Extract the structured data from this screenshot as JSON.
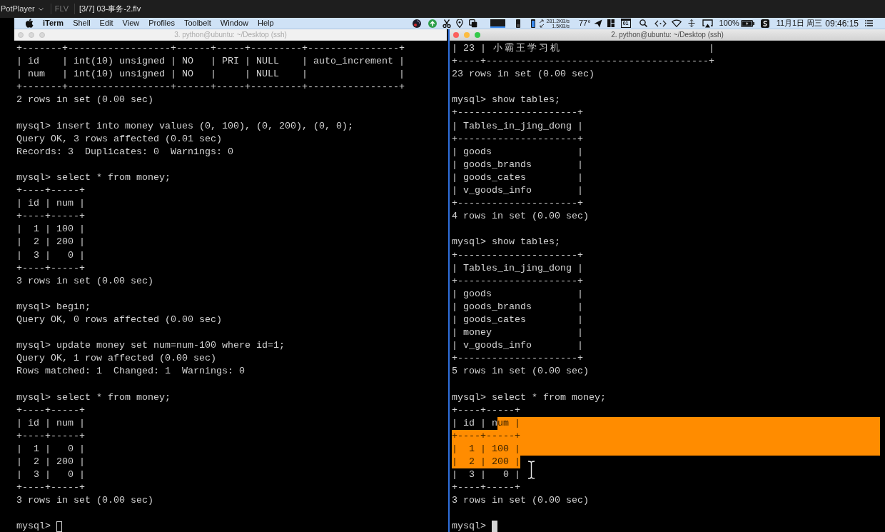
{
  "player_bar": {
    "app": "PotPlayer",
    "format": "FLV",
    "file_title": "[3/7] 03-事务-2.flv"
  },
  "menu_bar": {
    "items": [
      {
        "label": "iTerm",
        "kind": "app"
      },
      {
        "label": "Shell",
        "kind": "menu"
      },
      {
        "label": "Edit",
        "kind": "menu"
      },
      {
        "label": "View",
        "kind": "menu"
      },
      {
        "label": "Profiles",
        "kind": "menu"
      },
      {
        "label": "Toolbelt",
        "kind": "menu"
      },
      {
        "label": "Window",
        "kind": "menu"
      },
      {
        "label": "Help",
        "kind": "menu"
      }
    ],
    "upload_speed": "281.2KB/s",
    "download_speed": "1.5KB/s",
    "temperature": "77°",
    "calendar_day": "01",
    "battery": "100%",
    "date": "11月1日 周三",
    "time": "09:46:15"
  },
  "windows": [
    {
      "title": "3. python@ubuntu: ~/Desktop (ssh)",
      "focused": false,
      "blocks": [
        {
          "lines": [
            {
              "text": "+-------+------------------+------+-----+---------+----------------+",
              "selected": false
            },
            {
              "text": "| id    | int(10) unsigned | NO   | PRI | NULL    | auto_increment |",
              "selected": false
            },
            {
              "text": "| num   | int(10) unsigned | NO   |     | NULL    |                |",
              "selected": false
            },
            {
              "text": "+-------+------------------+------+-----+---------+----------------+",
              "selected": false
            },
            {
              "text": "2 rows in set (0.00 sec)",
              "selected": false
            }
          ]
        },
        {
          "lines": [
            {
              "text": "mysql> insert into money values (0, 100), (0, 200), (0, 0);",
              "selected": false
            },
            {
              "text": "Query OK, 3 rows affected (0.01 sec)",
              "selected": false
            },
            {
              "text": "Records: 3  Duplicates: 0  Warnings: 0",
              "selected": false
            }
          ]
        },
        {
          "lines": [
            {
              "text": "mysql> select * from money;",
              "selected": false
            },
            {
              "text": "+----+-----+",
              "selected": false
            },
            {
              "text": "| id | num |",
              "selected": false
            },
            {
              "text": "+----+-----+",
              "selected": false
            },
            {
              "text": "|  1 | 100 |",
              "selected": false
            },
            {
              "text": "|  2 | 200 |",
              "selected": false
            },
            {
              "text": "|  3 |   0 |",
              "selected": false
            },
            {
              "text": "+----+-----+",
              "selected": false
            },
            {
              "text": "3 rows in set (0.00 sec)",
              "selected": false
            }
          ]
        },
        {
          "lines": [
            {
              "text": "mysql> begin;",
              "selected": false
            },
            {
              "text": "Query OK, 0 rows affected (0.00 sec)",
              "selected": false
            }
          ]
        },
        {
          "lines": [
            {
              "text": "mysql> update money set num=num-100 where id=1;",
              "selected": false
            },
            {
              "text": "Query OK, 1 row affected (0.00 sec)",
              "selected": false
            },
            {
              "text": "Rows matched: 1  Changed: 1  Warnings: 0",
              "selected": false
            }
          ]
        },
        {
          "lines": [
            {
              "text": "mysql> select * from money;",
              "selected": false
            },
            {
              "text": "+----+-----+",
              "selected": false
            },
            {
              "text": "| id | num |",
              "selected": false
            },
            {
              "text": "+----+-----+",
              "selected": false
            },
            {
              "text": "|  1 |   0 |",
              "selected": false
            },
            {
              "text": "|  2 | 200 |",
              "selected": false
            },
            {
              "text": "|  3 |   0 |",
              "selected": false
            },
            {
              "text": "+----+-----+",
              "selected": false
            },
            {
              "text": "3 rows in set (0.00 sec)",
              "selected": false
            }
          ]
        },
        {
          "lines": [
            {
              "text": "mysql>",
              "selected": false,
              "cursor": true
            }
          ]
        }
      ]
    },
    {
      "title": "2. python@ubuntu: ~/Desktop (ssh)",
      "focused": true,
      "blocks": [
        {
          "lines": [
            {
              "text": "| 23 | 小霸王学习机                          |",
              "selected": false
            },
            {
              "text": "+----+---------------------------------------+",
              "selected": false
            },
            {
              "text": "23 rows in set (0.00 sec)",
              "selected": false
            }
          ]
        },
        {
          "lines": [
            {
              "text": "mysql> show tables;",
              "selected": false
            },
            {
              "text": "+---------------------+",
              "selected": false
            },
            {
              "text": "| Tables_in_jing_dong |",
              "selected": false
            },
            {
              "text": "+---------------------+",
              "selected": false
            },
            {
              "text": "| goods               |",
              "selected": false
            },
            {
              "text": "| goods_brands        |",
              "selected": false
            },
            {
              "text": "| goods_cates         |",
              "selected": false
            },
            {
              "text": "| v_goods_info        |",
              "selected": false
            },
            {
              "text": "+---------------------+",
              "selected": false
            },
            {
              "text": "4 rows in set (0.00 sec)",
              "selected": false
            }
          ]
        },
        {
          "lines": [
            {
              "text": "mysql> show tables;",
              "selected": false
            },
            {
              "text": "+---------------------+",
              "selected": false
            },
            {
              "text": "| Tables_in_jing_dong |",
              "selected": false
            },
            {
              "text": "+---------------------+",
              "selected": false
            },
            {
              "text": "| goods               |",
              "selected": false
            },
            {
              "text": "| goods_brands        |",
              "selected": false
            },
            {
              "text": "| goods_cates         |",
              "selected": false
            },
            {
              "text": "| money               |",
              "selected": false
            },
            {
              "text": "| v_goods_info        |",
              "selected": false
            },
            {
              "text": "+---------------------+",
              "selected": false
            },
            {
              "text": "5 rows in set (0.00 sec)",
              "selected": false
            }
          ]
        },
        {
          "lines": [
            {
              "text": "mysql> select * from money;",
              "selected": false
            },
            {
              "text": "+----+-----+",
              "selected": false
            },
            {
              "segments": [
                {
                  "text": "| id | n",
                  "selected": false
                },
                {
                  "text": "um |",
                  "selected": true
                }
              ],
              "selected": true
            },
            {
              "text": "+----+-----+",
              "selected": true
            },
            {
              "text": "|  1 | 100 |",
              "selected": true
            },
            {
              "segments": [
                {
                  "text": "|  2 | 200 |",
                  "selected": true
                }
              ],
              "selected": false
            },
            {
              "text": "|  3 |   0 |",
              "selected": false
            },
            {
              "text": "+----+-----+",
              "selected": false
            },
            {
              "text": "3 rows in set (0.00 sec)",
              "selected": false
            }
          ]
        },
        {
          "lines": [
            {
              "text": "mysql>",
              "selected": false,
              "cursor": true
            }
          ]
        }
      ]
    }
  ]
}
